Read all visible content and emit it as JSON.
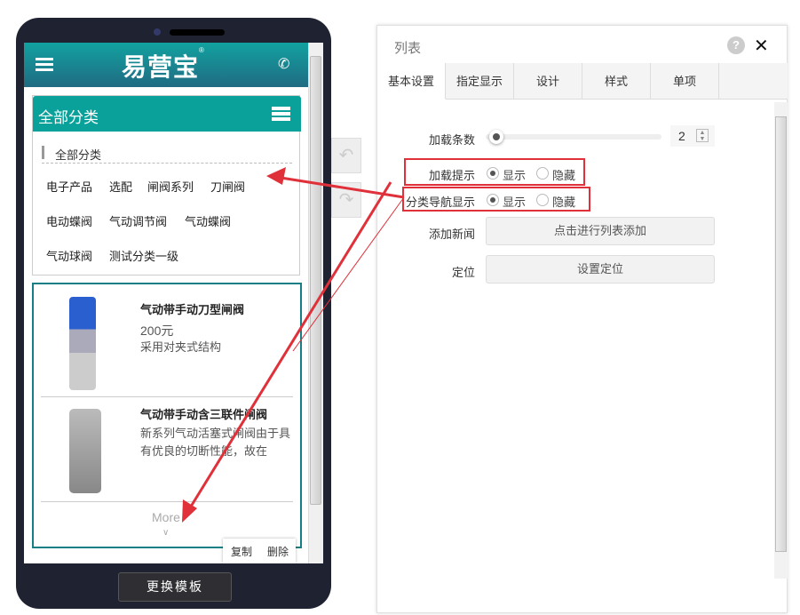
{
  "phone": {
    "logo": "易营宝",
    "logo_mark": "®",
    "category_header": "全部分类",
    "category_title": "全部分类",
    "categories": [
      "电子产品",
      "选配",
      "闸阀系列",
      "刀闸阀",
      "电动蝶阀",
      "气动调节阀",
      "气动蝶阀",
      "气动球阀",
      "测试分类一级"
    ],
    "products": [
      {
        "title": "气动带手动刀型闸阀",
        "price": "200元",
        "desc": "采用对夹式结构"
      },
      {
        "title": "气动带手动含三联件闸阀",
        "desc": "新系列气动活塞式闸阀由于具有优良的切断性能，故在"
      }
    ],
    "more": "More",
    "more_chevron": "∨",
    "copy": "复制",
    "delete": "删除",
    "change_template": "更换模板"
  },
  "panel": {
    "title": "列表",
    "tabs": [
      "基本设置",
      "指定显示",
      "设计",
      "样式",
      "单项"
    ],
    "load_count_label": "加载条数",
    "load_count": 2,
    "load_count_fraction": 0.0,
    "load_hint_label": "加载提示",
    "cat_nav_label": "分类导航显示",
    "show": "显示",
    "hide": "隐藏",
    "load_hint_value": "显示",
    "cat_nav_value": "显示",
    "add_news_label": "添加新闻",
    "add_news_button": "点击进行列表添加",
    "locate_label": "定位",
    "locate_button": "设置定位"
  },
  "colors": {
    "teal": "#0aa19a",
    "annotation": "#e0313a"
  }
}
